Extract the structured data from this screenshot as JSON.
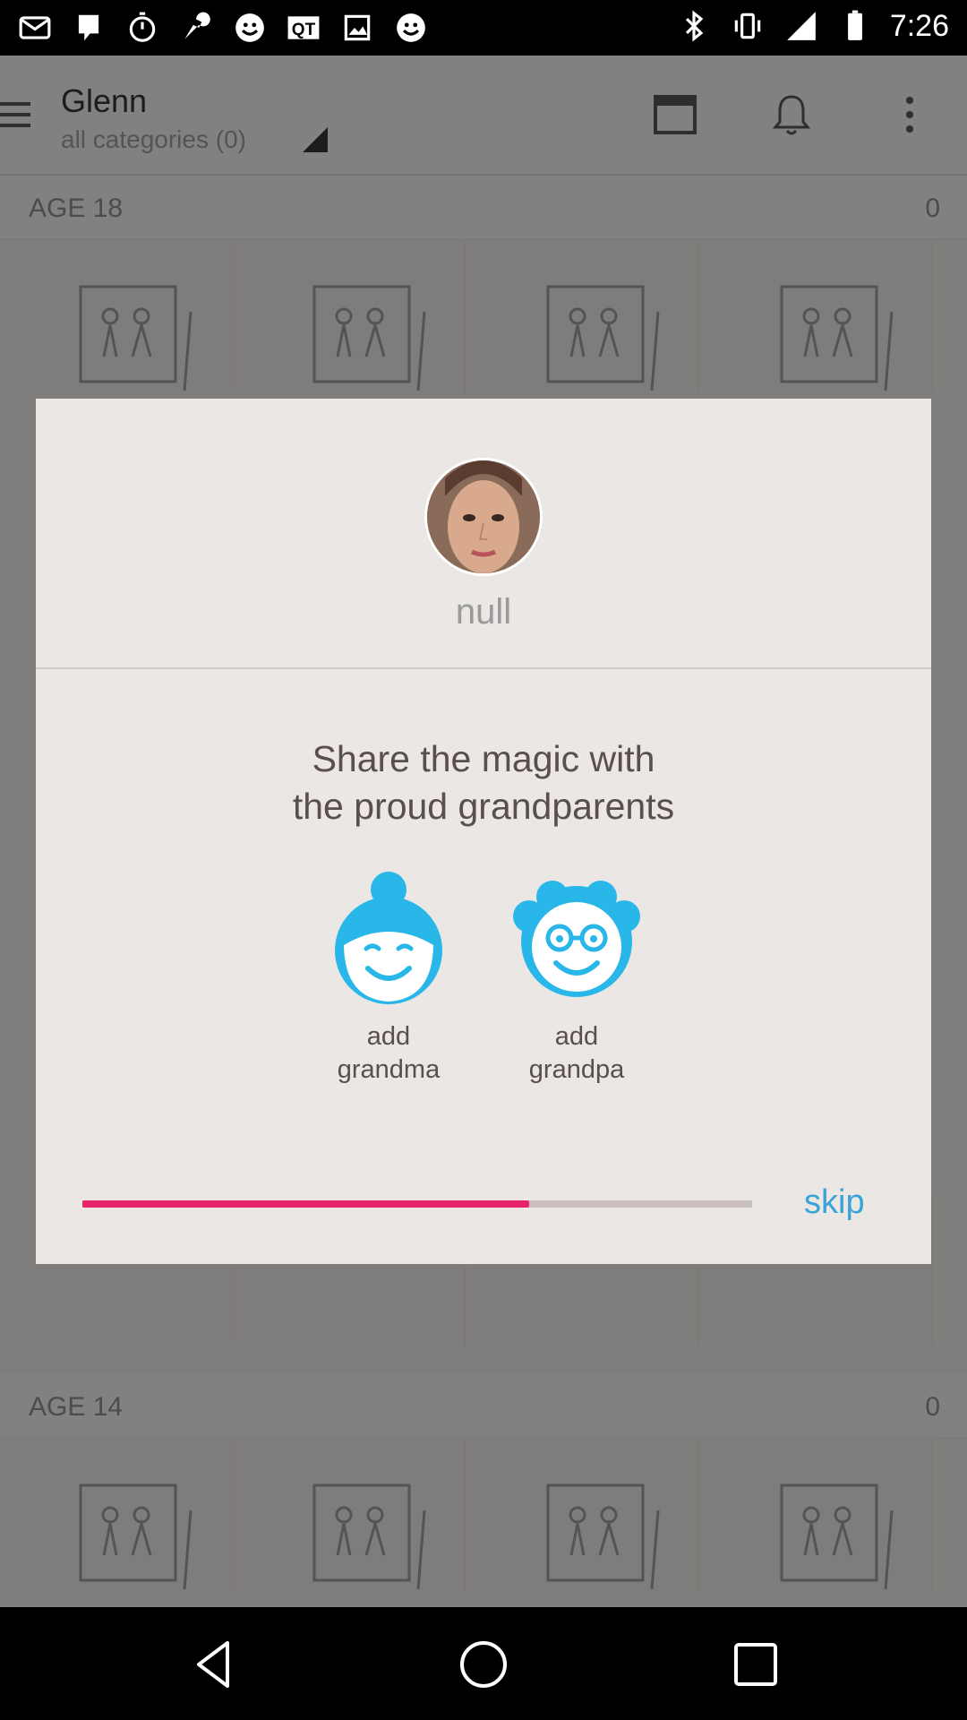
{
  "status_bar": {
    "time": "7:26",
    "left_icons": [
      "gmail-icon",
      "hangouts-icon",
      "stopwatch-icon",
      "wrench-icon",
      "smiley-icon",
      "qt-icon",
      "image-icon",
      "smiley-icon-2"
    ],
    "right_icons": [
      "bluetooth-icon",
      "vibrate-icon",
      "signal-icon",
      "battery-icon"
    ]
  },
  "app_bar": {
    "title": "Glenn",
    "subtitle": "all categories (0)"
  },
  "sections": [
    {
      "label": "AGE 18",
      "count": "0"
    },
    {
      "label": "AGE 14",
      "count": "0"
    }
  ],
  "dialog": {
    "profile_name": "null",
    "headline_line1": "Share the magic with",
    "headline_line2": "the proud grandparents",
    "grandma_label_line1": "add",
    "grandma_label_line2": "grandma",
    "grandpa_label_line1": "add",
    "grandpa_label_line2": "grandpa",
    "progress_fraction": 0.667,
    "skip_label": "skip",
    "accent_color": "#e8236e",
    "icon_color": "#29b6e8",
    "skip_color": "#3aa3d8"
  }
}
